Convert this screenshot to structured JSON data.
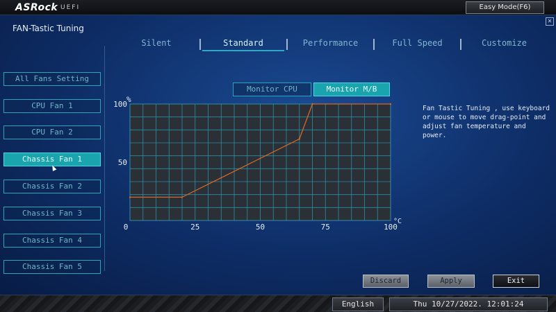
{
  "header": {
    "brand": "ASRock",
    "brand_sub": "UEFI",
    "easy_mode_label": "Easy Mode(F6)"
  },
  "page": {
    "title": "FAN-Tastic Tuning",
    "close_icon": "close-icon"
  },
  "tabs": [
    {
      "label": "Silent",
      "active": false
    },
    {
      "label": "Standard",
      "active": true
    },
    {
      "label": "Performance",
      "active": false
    },
    {
      "label": "Full Speed",
      "active": false
    },
    {
      "label": "Customize",
      "active": false
    }
  ],
  "fans": [
    {
      "label": "All Fans Setting",
      "active": false
    },
    {
      "label": "CPU Fan 1",
      "active": false
    },
    {
      "label": "CPU Fan 2",
      "active": false
    },
    {
      "label": "Chassis Fan 1",
      "active": true
    },
    {
      "label": "Chassis Fan 2",
      "active": false
    },
    {
      "label": "Chassis Fan 3",
      "active": false
    },
    {
      "label": "Chassis Fan 4",
      "active": false
    },
    {
      "label": "Chassis Fan 5",
      "active": false
    }
  ],
  "monitor": {
    "cpu_label": "Monitor CPU",
    "mb_label": "Monitor M/B",
    "active": "mb"
  },
  "help_text": "Fan Tastic Tuning , use keyboard\nor mouse to move drag-point and\nadjust fan temperature and power.",
  "actions": {
    "discard": "Discard",
    "apply": "Apply",
    "exit": "Exit"
  },
  "status": {
    "language": "English",
    "datetime": "Thu 10/27/2022. 12:01:24"
  },
  "colors": {
    "accent": "#1aa4ae",
    "curve": "#d2692a",
    "grid": "#2d8fa8",
    "plot_bg": "#2b2f36"
  },
  "chart_data": {
    "type": "line",
    "xlabel": "°C",
    "ylabel": "%",
    "x_ticks": [
      "0",
      "25",
      "50",
      "75",
      "100"
    ],
    "y_ticks": [
      "50",
      "100"
    ],
    "xlim": [
      0,
      100
    ],
    "ylim": [
      0,
      100
    ],
    "grid": true,
    "series": [
      {
        "x": [
          0,
          20,
          65,
          70,
          100
        ],
        "y": [
          20,
          20,
          70,
          100,
          100
        ]
      }
    ]
  }
}
